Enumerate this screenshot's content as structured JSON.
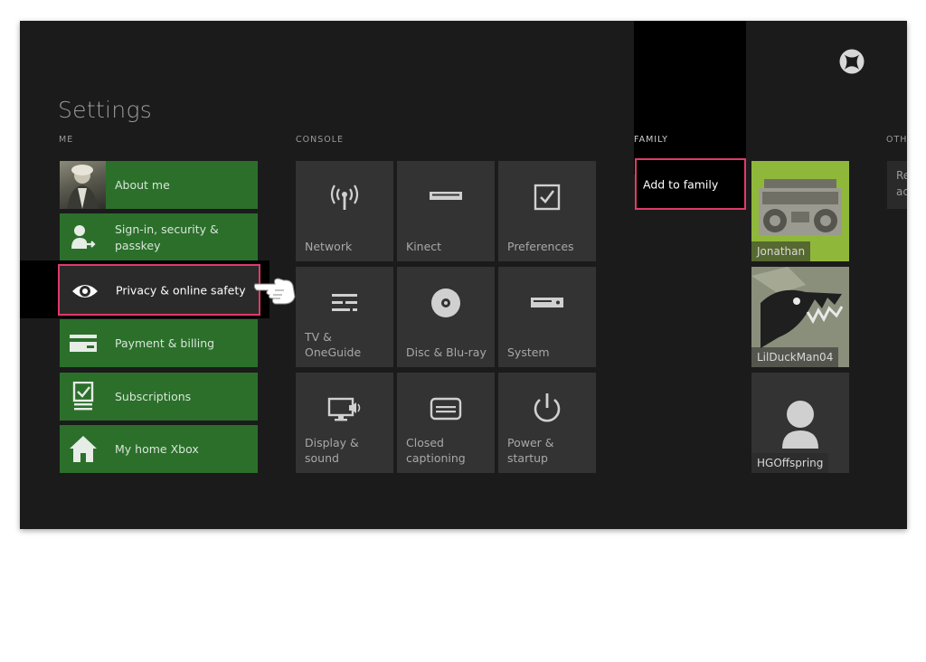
{
  "header": {
    "title": "Settings"
  },
  "sections": {
    "me": "ME",
    "console": "CONSOLE",
    "family": "FAMILY",
    "other": "OTH"
  },
  "me_items": [
    {
      "label": "About me",
      "icon": "avatar-photo"
    },
    {
      "label": "Sign-in, security & passkey",
      "icon": "person-signin-icon"
    },
    {
      "label": "Privacy & online safety",
      "icon": "eye-icon",
      "selected": true
    },
    {
      "label": "Payment & billing",
      "icon": "credit-card-icon"
    },
    {
      "label": "Subscriptions",
      "icon": "subscription-checklist-icon"
    },
    {
      "label": "My home Xbox",
      "icon": "home-icon"
    }
  ],
  "console_items": [
    {
      "label": "Network",
      "icon": "wireless-antenna-icon"
    },
    {
      "label": "Kinect",
      "icon": "kinect-sensor-icon"
    },
    {
      "label": "Preferences",
      "icon": "checkbox-icon"
    },
    {
      "label": "TV & OneGuide",
      "icon": "guide-lines-icon"
    },
    {
      "label": "Disc & Blu-ray",
      "icon": "disc-icon"
    },
    {
      "label": "System",
      "icon": "console-icon"
    },
    {
      "label": "Display & sound",
      "icon": "monitor-speaker-icon"
    },
    {
      "label": "Closed captioning",
      "icon": "caption-icon"
    },
    {
      "label": "Power & startup",
      "icon": "power-icon"
    }
  ],
  "family": {
    "add_label": "Add to family",
    "members": [
      {
        "name": "Jonathan",
        "icon": "boombox-gamerpic"
      },
      {
        "name": "LilDuckMan04",
        "icon": "dragon-gamerpic"
      },
      {
        "name": "HGOffspring",
        "icon": "default-person-gamerpic"
      }
    ]
  },
  "other_tile_text": "Re ac",
  "colors": {
    "background": "#1b1b1b",
    "me_tile": "#2b6f2b",
    "console_tile": "#333333",
    "selection_border": "#e03a6a",
    "jonathan_bg": "#8fb83a"
  }
}
